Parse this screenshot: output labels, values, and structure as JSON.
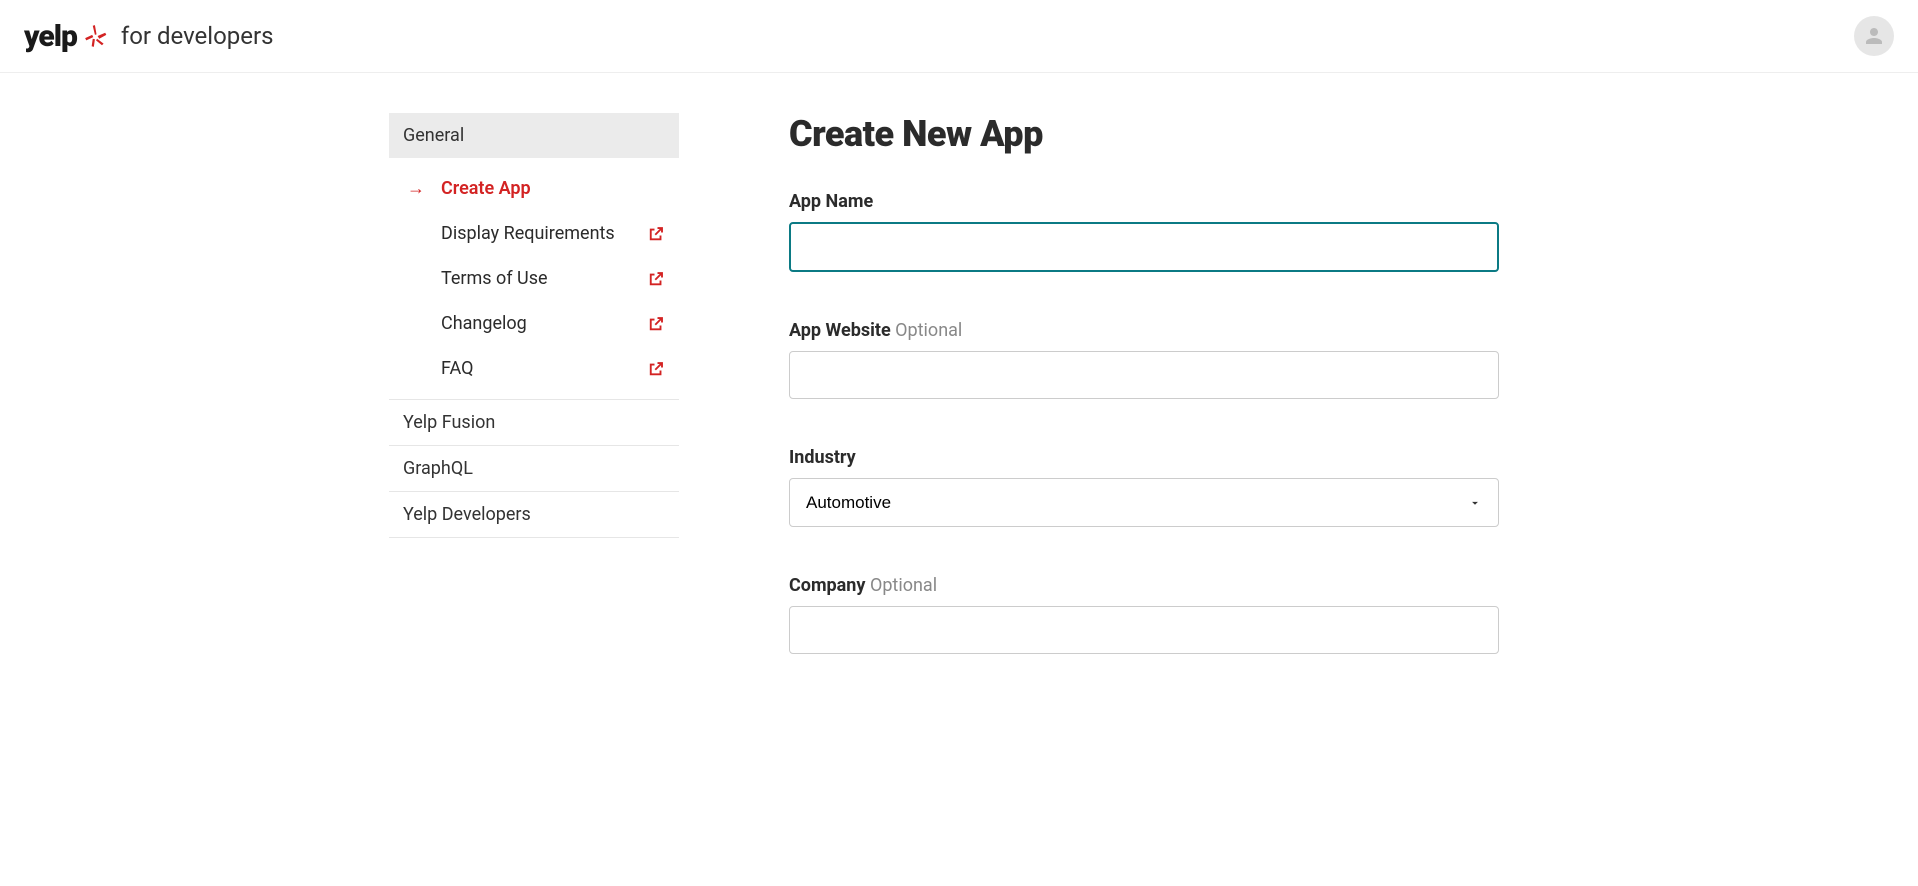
{
  "header": {
    "logo_text": "yelp",
    "subtitle": "for developers"
  },
  "sidebar": {
    "sections": [
      {
        "label": "General",
        "active": true
      },
      {
        "label": "Yelp Fusion",
        "active": false
      },
      {
        "label": "GraphQL",
        "active": false
      },
      {
        "label": "Yelp Developers",
        "active": false
      }
    ],
    "general_items": [
      {
        "label": "Create App",
        "active": true,
        "external": false
      },
      {
        "label": "Display Requirements",
        "active": false,
        "external": true
      },
      {
        "label": "Terms of Use",
        "active": false,
        "external": true
      },
      {
        "label": "Changelog",
        "active": false,
        "external": true
      },
      {
        "label": "FAQ",
        "active": false,
        "external": true
      }
    ]
  },
  "form": {
    "title": "Create New App",
    "app_name": {
      "label": "App Name",
      "value": ""
    },
    "app_website": {
      "label": "App Website",
      "optional": "Optional",
      "value": ""
    },
    "industry": {
      "label": "Industry",
      "selected": "Automotive"
    },
    "company": {
      "label": "Company",
      "optional": "Optional",
      "value": ""
    }
  }
}
